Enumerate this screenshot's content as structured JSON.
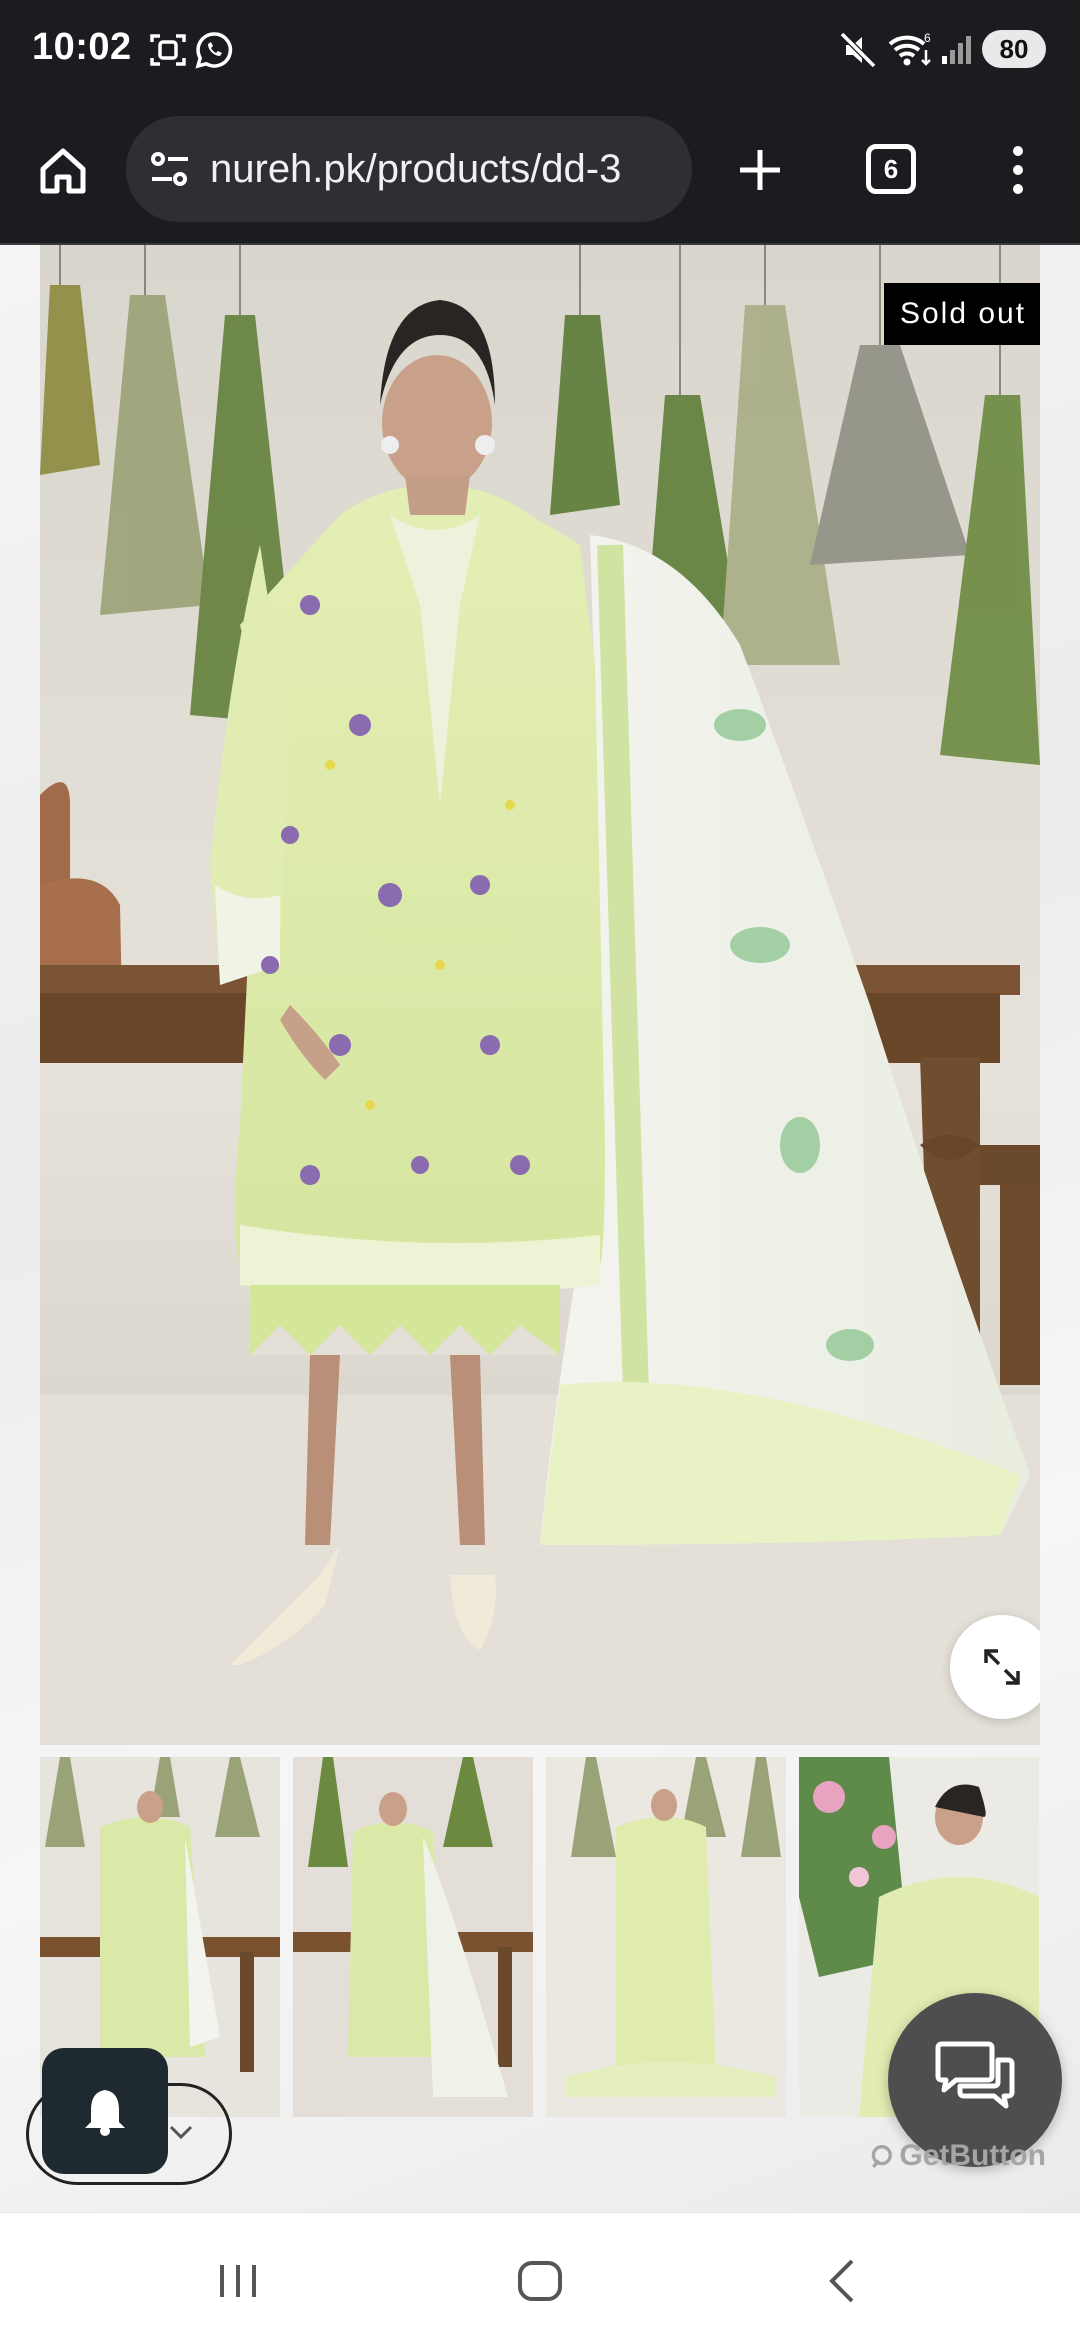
{
  "status_bar": {
    "time": "10:02",
    "battery": "80",
    "icons": [
      "screenshot-icon",
      "whatsapp-icon",
      "mute-icon",
      "wifi-icon",
      "signal-icon"
    ]
  },
  "browser": {
    "url": "nureh.pk/products/dd-3",
    "tab_count": "6",
    "icons": [
      "home-icon",
      "site-settings-icon",
      "new-tab-icon",
      "tabs-icon",
      "menu-icon"
    ]
  },
  "product": {
    "badge": "Sold out",
    "thumbnails": [
      "Thumbnail 1",
      "Thumbnail 2",
      "Thumbnail 3",
      "Thumbnail 4"
    ]
  },
  "widgets": {
    "chat_brand": "GetButton"
  },
  "colors": {
    "system_bar": "#1b1c20",
    "omnibox": "#2d2f35",
    "badge_bg": "#000000",
    "dress_green": "#dbe9a8",
    "table_wood": "#7a5230",
    "chat_button": "#4e4e4e",
    "notify_button": "#1f2a30"
  }
}
